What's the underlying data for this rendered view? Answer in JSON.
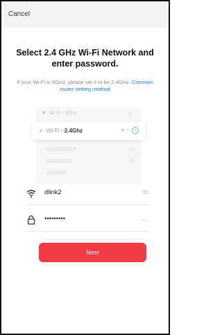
{
  "header": {
    "cancel_label": "Cancel"
  },
  "main": {
    "title": "Select 2.4 GHz Wi-Fi Network and enter password.",
    "subtitle_text": "If your Wi-Fi is 5GHz, please set it to be 2.4GHz.",
    "subtitle_link": "Common router setting method"
  },
  "illustration": {
    "row_5g": "Wi-Fi - 5Ghz",
    "row_24_prefix": "Wi-Fi - ",
    "row_24_bold": "2.4Ghz",
    "info_symbol": "i",
    "icons": [
      "lock-icon",
      "wifi-icon",
      "info-icon"
    ]
  },
  "form": {
    "ssid_value": "dlink2",
    "password_masked": "•••••••••",
    "next_label": "Next"
  },
  "colors": {
    "accent": "#f23a46",
    "link": "#1f7bd9",
    "check": "#2fb36d"
  }
}
